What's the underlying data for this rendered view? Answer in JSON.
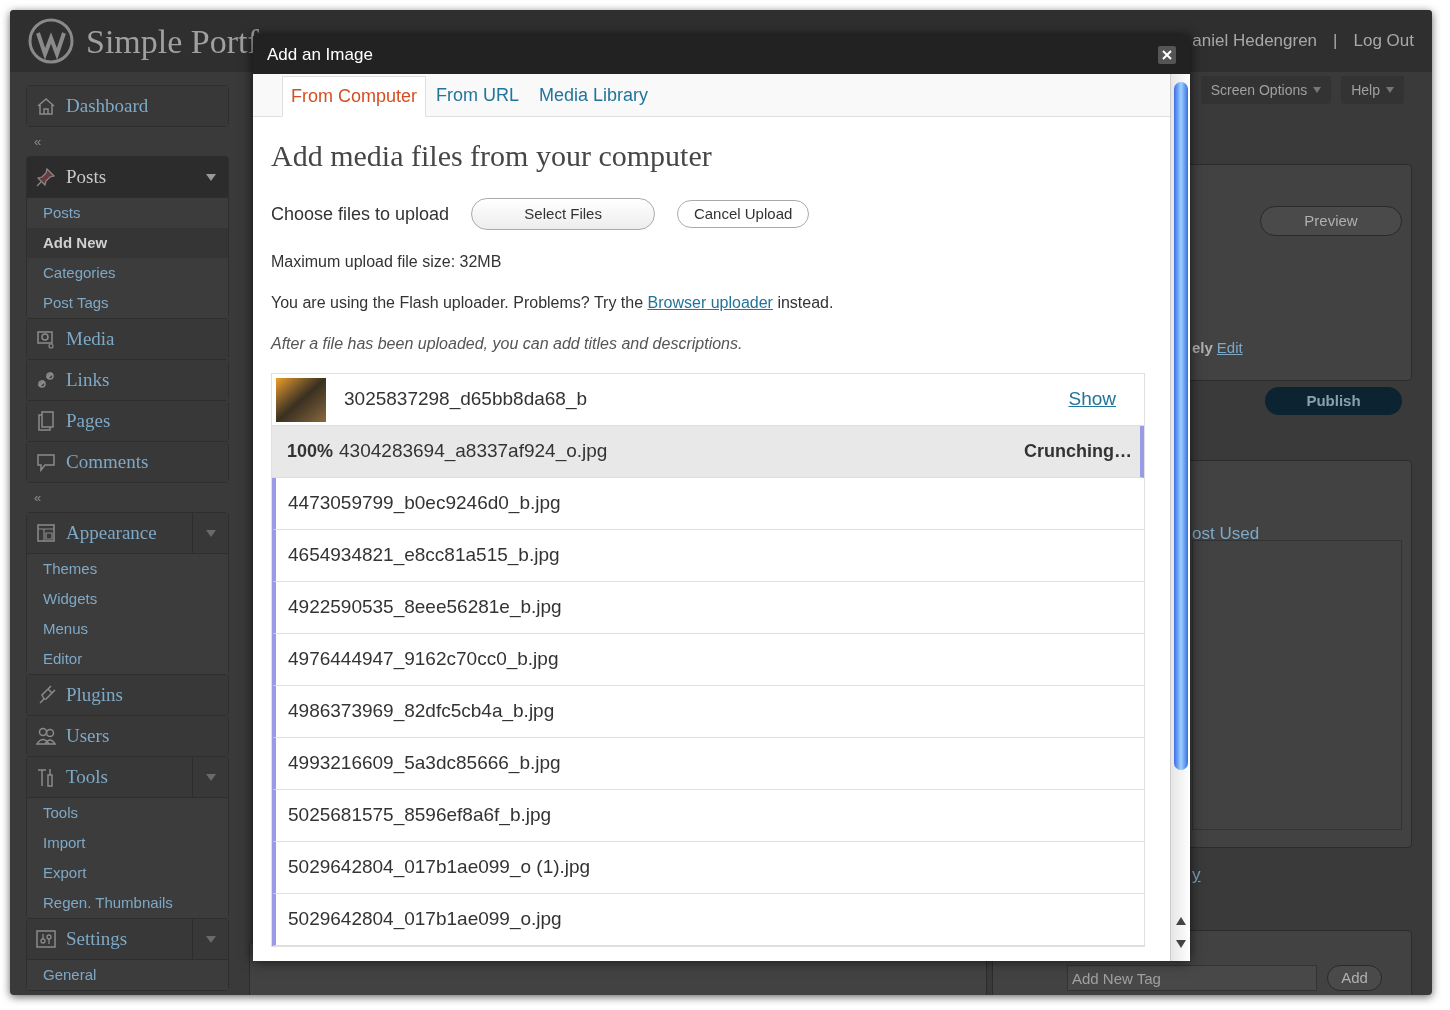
{
  "header": {
    "site_title": "Simple Portf",
    "user_name": "aniel Hedengren",
    "separator": "|",
    "logout": "Log Out"
  },
  "screen_meta": [
    "Screen Options",
    "Help"
  ],
  "menu": [
    {
      "kind": "item",
      "label": "Dashboard",
      "selected": false,
      "has_toggle": false
    },
    {
      "kind": "separator",
      "label": "«"
    },
    {
      "kind": "item",
      "label": "Posts",
      "selected": true,
      "has_toggle": true,
      "children": [
        {
          "label": "Posts",
          "selected": false
        },
        {
          "label": "Add New",
          "selected": true
        },
        {
          "label": "Categories",
          "selected": false
        },
        {
          "label": "Post Tags",
          "selected": false
        }
      ]
    },
    {
      "kind": "item",
      "label": "Media",
      "selected": false,
      "has_toggle": false
    },
    {
      "kind": "item",
      "label": "Links",
      "selected": false,
      "has_toggle": false
    },
    {
      "kind": "item",
      "label": "Pages",
      "selected": false,
      "has_toggle": false
    },
    {
      "kind": "item",
      "label": "Comments",
      "selected": false,
      "has_toggle": false
    },
    {
      "kind": "separator",
      "label": "«"
    },
    {
      "kind": "item",
      "label": "Appearance",
      "selected": false,
      "has_toggle": true,
      "children": [
        {
          "label": "Themes",
          "selected": false
        },
        {
          "label": "Widgets",
          "selected": false
        },
        {
          "label": "Menus",
          "selected": false
        },
        {
          "label": "Editor",
          "selected": false
        }
      ]
    },
    {
      "kind": "item",
      "label": "Plugins",
      "selected": false,
      "has_toggle": false
    },
    {
      "kind": "item",
      "label": "Users",
      "selected": false,
      "has_toggle": false
    },
    {
      "kind": "item",
      "label": "Tools",
      "selected": false,
      "has_toggle": true,
      "children": [
        {
          "label": "Tools",
          "selected": false
        },
        {
          "label": "Import",
          "selected": false
        },
        {
          "label": "Export",
          "selected": false
        },
        {
          "label": "Regen. Thumbnails",
          "selected": false
        }
      ]
    },
    {
      "kind": "item",
      "label": "Settings",
      "selected": false,
      "has_toggle": true,
      "children": [
        {
          "label": "General",
          "selected": false
        }
      ]
    }
  ],
  "side_panel": {
    "preview_button": "Preview",
    "schedule_text": "ely",
    "edit_link": "Edit",
    "publish_button": "Publish",
    "categories_tab": "ost Used",
    "categories_link": "y",
    "tag_field": {
      "placeholder": "Add New Tag"
    },
    "add_button": "Add"
  },
  "dialog": {
    "title": "Add an Image",
    "tabs": [
      {
        "label": "From Computer",
        "selected": true
      },
      {
        "label": "From URL",
        "selected": false
      },
      {
        "label": "Media Library",
        "selected": false
      }
    ],
    "heading": "Add media files from your computer",
    "choose_label": "Choose files to upload",
    "select_button": "Select Files",
    "cancel_button": "Cancel Upload",
    "max_size": "Maximum upload file size: 32MB",
    "flash_text": {
      "before": "You are using the Flash uploader. Problems? Try the ",
      "link": "Browser uploader",
      "after": " instead."
    },
    "hint": "After a file has been uploaded, you can add titles and descriptions.",
    "files": [
      {
        "kind": "done",
        "name": "3025837298_d65bb8da68_b",
        "action": "Show"
      },
      {
        "kind": "processing",
        "percent": "100%",
        "name": "4304283694_a8337af924_o.jpg",
        "status": "Crunching…"
      },
      {
        "kind": "queued",
        "name": "4473059799_b0ec9246d0_b.jpg"
      },
      {
        "kind": "queued",
        "name": "4654934821_e8cc81a515_b.jpg"
      },
      {
        "kind": "queued",
        "name": "4922590535_8eee56281e_b.jpg"
      },
      {
        "kind": "queued",
        "name": "4976444947_9162c70cc0_b.jpg"
      },
      {
        "kind": "queued",
        "name": "4986373969_82dfc5cb4a_b.jpg"
      },
      {
        "kind": "queued",
        "name": "4993216609_5a3dc85666_b.jpg"
      },
      {
        "kind": "queued",
        "name": "5025681575_8596ef8a6f_b.jpg"
      },
      {
        "kind": "queued",
        "name": "5029642804_017b1ae099_o (1).jpg"
      },
      {
        "kind": "queued",
        "name": "5029642804_017b1ae099_o.jpg"
      }
    ]
  }
}
